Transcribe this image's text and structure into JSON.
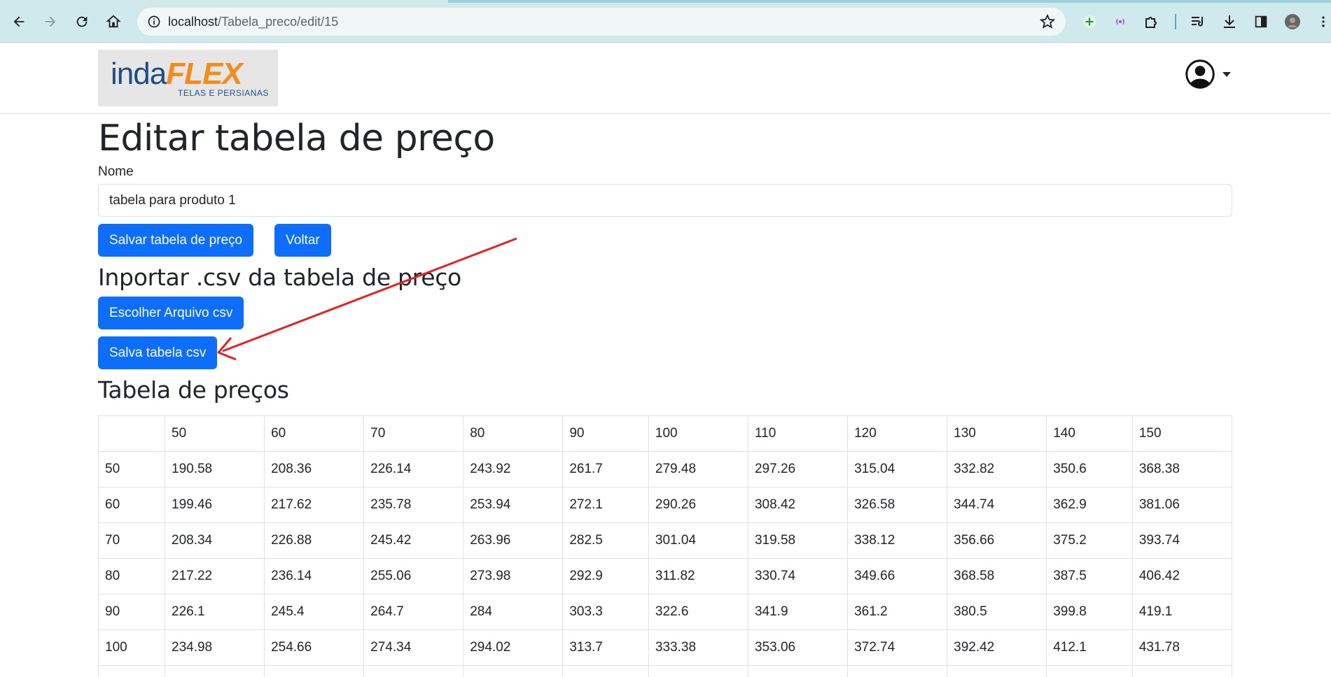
{
  "browser": {
    "url_host": "localhost",
    "url_path": "/Tabela_preco/edit/15"
  },
  "header": {
    "logo_inda": "inda",
    "logo_flex": "FLEX",
    "logo_tagline": "TELAS E PERSIANAS"
  },
  "page": {
    "title": "Editar tabela de preço",
    "name_label": "Nome",
    "name_value": "tabela para produto 1",
    "save_label": "Salvar tabela de preço",
    "back_label": "Voltar",
    "import_heading": "Inportar .csv da tabela de preço",
    "choose_file_label": "Escolher Arquivo csv",
    "save_csv_label": "Salva tabela csv",
    "table_heading": "Tabela de preços"
  },
  "table": {
    "header": [
      "",
      "50",
      "60",
      "70",
      "80",
      "90",
      "100",
      "110",
      "120",
      "130",
      "140",
      "150"
    ],
    "rows": [
      [
        "50",
        "190.58",
        "208.36",
        "226.14",
        "243.92",
        "261.7",
        "279.48",
        "297.26",
        "315.04",
        "332.82",
        "350.6",
        "368.38"
      ],
      [
        "60",
        "199.46",
        "217.62",
        "235.78",
        "253.94",
        "272.1",
        "290.26",
        "308.42",
        "326.58",
        "344.74",
        "362.9",
        "381.06"
      ],
      [
        "70",
        "208.34",
        "226.88",
        "245.42",
        "263.96",
        "282.5",
        "301.04",
        "319.58",
        "338.12",
        "356.66",
        "375.2",
        "393.74"
      ],
      [
        "80",
        "217.22",
        "236.14",
        "255.06",
        "273.98",
        "292.9",
        "311.82",
        "330.74",
        "349.66",
        "368.58",
        "387.5",
        "406.42"
      ],
      [
        "90",
        "226.1",
        "245.4",
        "264.7",
        "284",
        "303.3",
        "322.6",
        "341.9",
        "361.2",
        "380.5",
        "399.8",
        "419.1"
      ],
      [
        "100",
        "234.98",
        "254.66",
        "274.34",
        "294.02",
        "313.7",
        "333.38",
        "353.06",
        "372.74",
        "392.42",
        "412.1",
        "431.78"
      ],
      [
        "",
        "",
        "",
        "",
        "",
        "",
        "",
        "",
        "",
        "",
        "",
        ""
      ]
    ]
  },
  "colors": {
    "primary": "#0d6efd",
    "annotation_arrow": "#e02424",
    "brand_blue": "#1d4e89",
    "brand_orange": "#f28c1a"
  }
}
